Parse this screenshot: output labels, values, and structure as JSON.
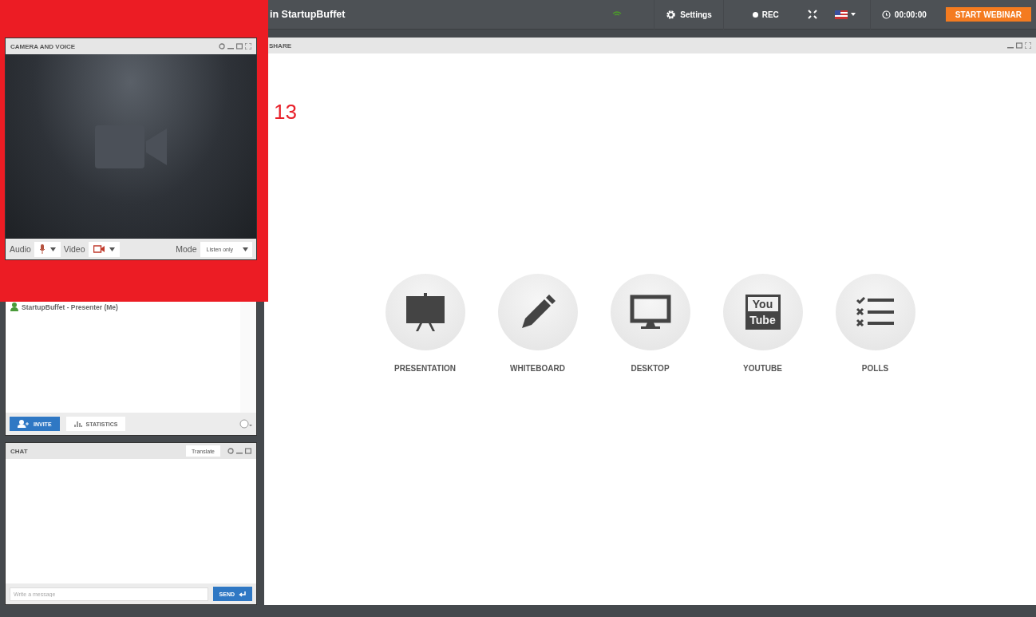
{
  "top_bar": {
    "title": "in StartupBuffet",
    "settings": "Settings",
    "rec": "REC",
    "timer": "00:00:00",
    "start_button": "START WEBINAR"
  },
  "annotation": {
    "label": "13"
  },
  "camera_panel": {
    "title": "CAMERA AND VOICE",
    "audio_label": "Audio",
    "video_label": "Video",
    "mode_label": "Mode",
    "mode_value": "Listen only"
  },
  "participants": {
    "items": [
      {
        "name": "StartupBuffet - Presenter (Me)"
      }
    ],
    "invite": "INVITE",
    "statistics": "STATISTICS"
  },
  "chat": {
    "title": "CHAT",
    "translate": "Translate",
    "placeholder": "Write a message",
    "send": "SEND"
  },
  "share": {
    "title": "SHARE",
    "options": [
      {
        "kind": "presentation",
        "label": "PRESENTATION"
      },
      {
        "kind": "whiteboard",
        "label": "WHITEBOARD"
      },
      {
        "kind": "desktop",
        "label": "DESKTOP"
      },
      {
        "kind": "youtube",
        "label": "YOUTUBE",
        "logo": [
          "You",
          "Tube"
        ]
      },
      {
        "kind": "polls",
        "label": "POLLS"
      }
    ]
  }
}
